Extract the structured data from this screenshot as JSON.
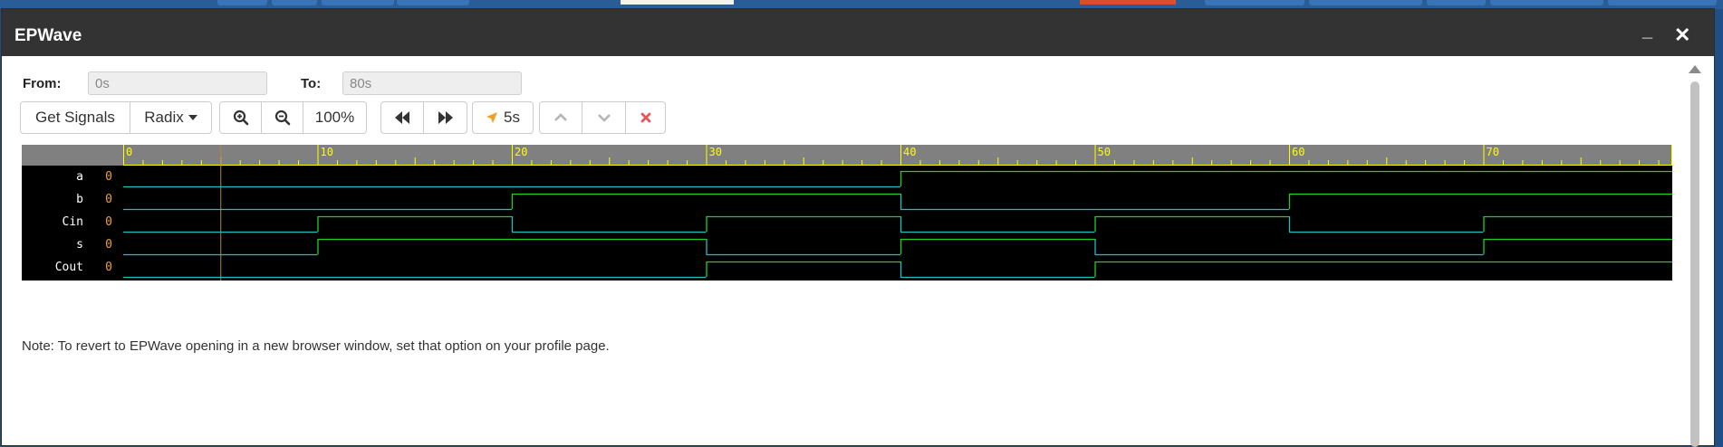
{
  "window": {
    "title": "EPWave",
    "minimize_glyph": "_",
    "close_glyph": "✕"
  },
  "range": {
    "from_label": "From:",
    "from_value": "0s",
    "to_label": "To:",
    "to_value": "80s"
  },
  "toolbar": {
    "get_signals_label": "Get Signals",
    "radix_label": "Radix",
    "zoom_level": "100%",
    "cursor_time": "5s",
    "icons": {
      "zoom_in": "zoom-in-icon",
      "zoom_out": "zoom-out-icon",
      "rewind": "backward-icon",
      "forward": "forward-icon",
      "cursor": "location-arrow-icon",
      "up": "chevron-up-icon",
      "down": "chevron-down-icon",
      "remove": "times-icon"
    },
    "colors": {
      "remove": "#e8545c",
      "cursor_icon": "#f0a020"
    }
  },
  "waveform": {
    "time_min": 0,
    "time_max": 80,
    "major_ticks": [
      0,
      10,
      20,
      30,
      40,
      50,
      60,
      70
    ],
    "tick_labels": [
      "0",
      "10",
      "20",
      "30",
      "40",
      "50",
      "60",
      "70"
    ],
    "cursor_time": 5,
    "colors": {
      "background": "#000000",
      "ruler": "#808080",
      "ruler_text": "#ffff00",
      "cursor": "#c08040",
      "signal_name": "#ffffff",
      "value_text": "#f0a030",
      "trace_low": "#20c0c0",
      "trace_high": "#20d020"
    },
    "signals": [
      {
        "name": "a",
        "value": "0",
        "transitions": [
          [
            0,
            0
          ],
          [
            40,
            1
          ]
        ]
      },
      {
        "name": "b",
        "value": "0",
        "transitions": [
          [
            0,
            0
          ],
          [
            20,
            1
          ],
          [
            40,
            0
          ],
          [
            60,
            1
          ]
        ]
      },
      {
        "name": "Cin",
        "value": "0",
        "transitions": [
          [
            0,
            0
          ],
          [
            10,
            1
          ],
          [
            20,
            0
          ],
          [
            30,
            1
          ],
          [
            40,
            0
          ],
          [
            50,
            1
          ],
          [
            60,
            0
          ],
          [
            70,
            1
          ]
        ]
      },
      {
        "name": "s",
        "value": "0",
        "transitions": [
          [
            0,
            0
          ],
          [
            10,
            1
          ],
          [
            30,
            0
          ],
          [
            40,
            1
          ],
          [
            50,
            0
          ],
          [
            70,
            1
          ]
        ]
      },
      {
        "name": "Cout",
        "value": "0",
        "transitions": [
          [
            0,
            0
          ],
          [
            30,
            1
          ],
          [
            40,
            0
          ],
          [
            50,
            1
          ]
        ]
      }
    ]
  },
  "note": "Note: To revert to EPWave opening in a new browser window, set that option on your profile page."
}
